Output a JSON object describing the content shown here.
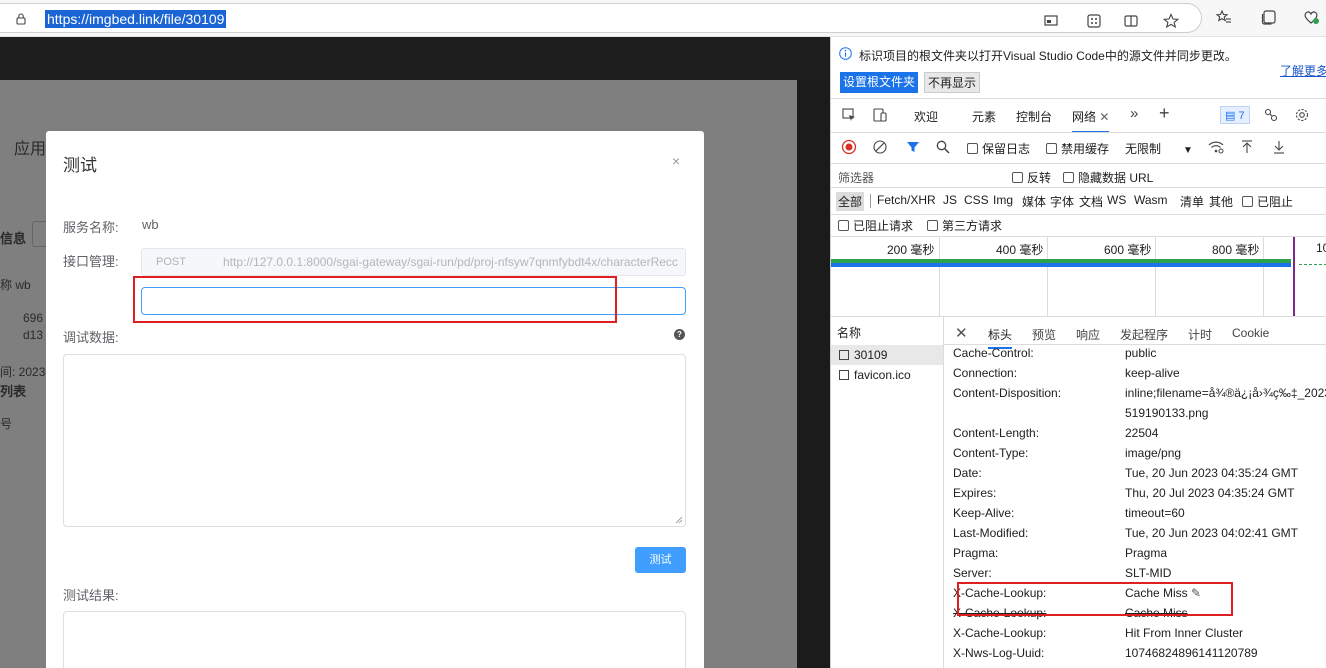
{
  "browser": {
    "url": "https://imgbed.link/file/30109"
  },
  "page": {
    "heading_fragment": "应用",
    "info_fragment": "信息",
    "name_fragment": "称 wb",
    "id_fragment_1": "696",
    "id_fragment_2": "d13",
    "time_fragment": "间: 2023",
    "list_fragment": "列表",
    "col_fragment": "号"
  },
  "modal": {
    "title": "测试",
    "close": "×",
    "service_label": "服务名称:",
    "service_value": "wb",
    "api_label": "接口管理:",
    "method": "POST",
    "api_url": "http://127.0.0.1:8000/sgai-gateway/sgai-run/pd/proj-nfsyw7qnmfybdt4x/characterRecc",
    "debug_label": "调试数据:",
    "test_button": "测试",
    "result_label": "测试结果:"
  },
  "devtools": {
    "info_text": "标识项目的根文件夹以打开Visual Studio Code中的源文件并同步更改。",
    "learn_more": "了解更多",
    "set_root_button": "设置根文件夹",
    "dont_show_button": "不再显示",
    "tabs": [
      "欢迎",
      "元素",
      "控制台",
      "网络"
    ],
    "issues_count": "7",
    "preserve_log": "保留日志",
    "disable_cache": "禁用缓存",
    "throttle": "无限制",
    "filter_placeholder": "筛选器",
    "invert": "反转",
    "hide_data_urls": "隐藏数据 URL",
    "type_filters": [
      "全部",
      "Fetch/XHR",
      "JS",
      "CSS",
      "Img",
      "媒体",
      "字体",
      "文档",
      "WS",
      "Wasm",
      "清单",
      "其他"
    ],
    "blocked_partial": "已阻止",
    "blocked_requests": "已阻止请求",
    "third_party": "第三方请求",
    "timeline_ticks": [
      "200 毫秒",
      "400 毫秒",
      "600 毫秒",
      "800 毫秒",
      "10"
    ],
    "name_col": "名称",
    "requests": [
      "30109",
      "favicon.ico"
    ],
    "detail_tabs": [
      "标头",
      "预览",
      "响应",
      "发起程序",
      "计时",
      "Cookie"
    ],
    "headers": [
      {
        "name": "Cache-Control:",
        "value": "public"
      },
      {
        "name": "Connection:",
        "value": "keep-alive"
      },
      {
        "name": "Content-Disposition:",
        "value": "inline;filename=å¾®ä¿¡å›¾ç‰‡_2023"
      },
      {
        "name": "",
        "value": "519190133.png"
      },
      {
        "name": "Content-Length:",
        "value": "22504"
      },
      {
        "name": "Content-Type:",
        "value": "image/png"
      },
      {
        "name": "Date:",
        "value": "Tue, 20 Jun 2023 04:35:24 GMT"
      },
      {
        "name": "Expires:",
        "value": "Thu, 20 Jul 2023 04:35:24 GMT"
      },
      {
        "name": "Keep-Alive:",
        "value": "timeout=60"
      },
      {
        "name": "Last-Modified:",
        "value": "Tue, 20 Jun 2023 04:02:41 GMT"
      },
      {
        "name": "Pragma:",
        "value": "Pragma"
      },
      {
        "name": "Server:",
        "value": "SLT-MID"
      },
      {
        "name": "X-Cache-Lookup:",
        "value": "Cache Miss"
      },
      {
        "name": "X-Cache-Lookup:",
        "value": "Cache Miss"
      },
      {
        "name": "X-Cache-Lookup:",
        "value": "Hit From Inner Cluster"
      },
      {
        "name": "X-Nws-Log-Uuid:",
        "value": "10746824896141120789"
      }
    ]
  },
  "colors": {
    "accent": "#409eff",
    "devtools_blue": "#1a73e8",
    "annotation_red": "#e02020"
  }
}
